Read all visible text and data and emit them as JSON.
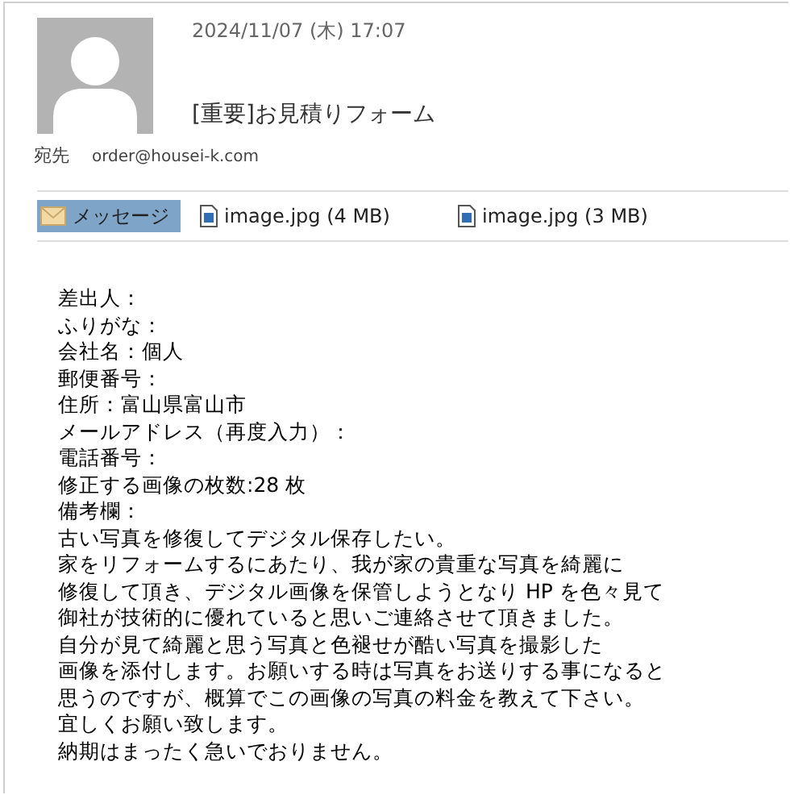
{
  "message": {
    "date": "2024/11/07 (木) 17:07",
    "subject": "[重要]お見積りフォーム",
    "to_label": "宛先",
    "to": "order@housei-k.com"
  },
  "tabs": [
    {
      "kind": "message",
      "label": "メッセージ",
      "selected": true
    },
    {
      "kind": "attachment",
      "label": "image.jpg (4 MB)",
      "selected": false
    },
    {
      "kind": "attachment",
      "label": "image.jpg (3 MB)",
      "selected": false
    }
  ],
  "body_lines": [
    "差出人：",
    "ふりがな：",
    "会社名：個人",
    "郵便番号：",
    "住所：富山県富山市",
    "メールアドレス（再度入力）：",
    "電話番号：",
    "修正する画像の枚数:28 枚",
    "備考欄：",
    "古い写真を修復してデジタル保存したい。",
    "家をリフォームするにあたり、我が家の貴重な写真を綺麗に",
    "修復して頂き、デジタル画像を保管しようとなり HP を色々見て",
    "御社が技術的に優れていると思いご連絡させて頂きました。",
    "自分が見て綺麗と思う写真と色褪せが酷い写真を撮影した",
    "画像を添付します。お願いする時は写真をお送りする事になると",
    "思うのですが、概算でこの画像の写真の料金を教えて下さい。",
    "宜しくお願い致します。",
    "納期はまったく急いでおりません。"
  ]
}
